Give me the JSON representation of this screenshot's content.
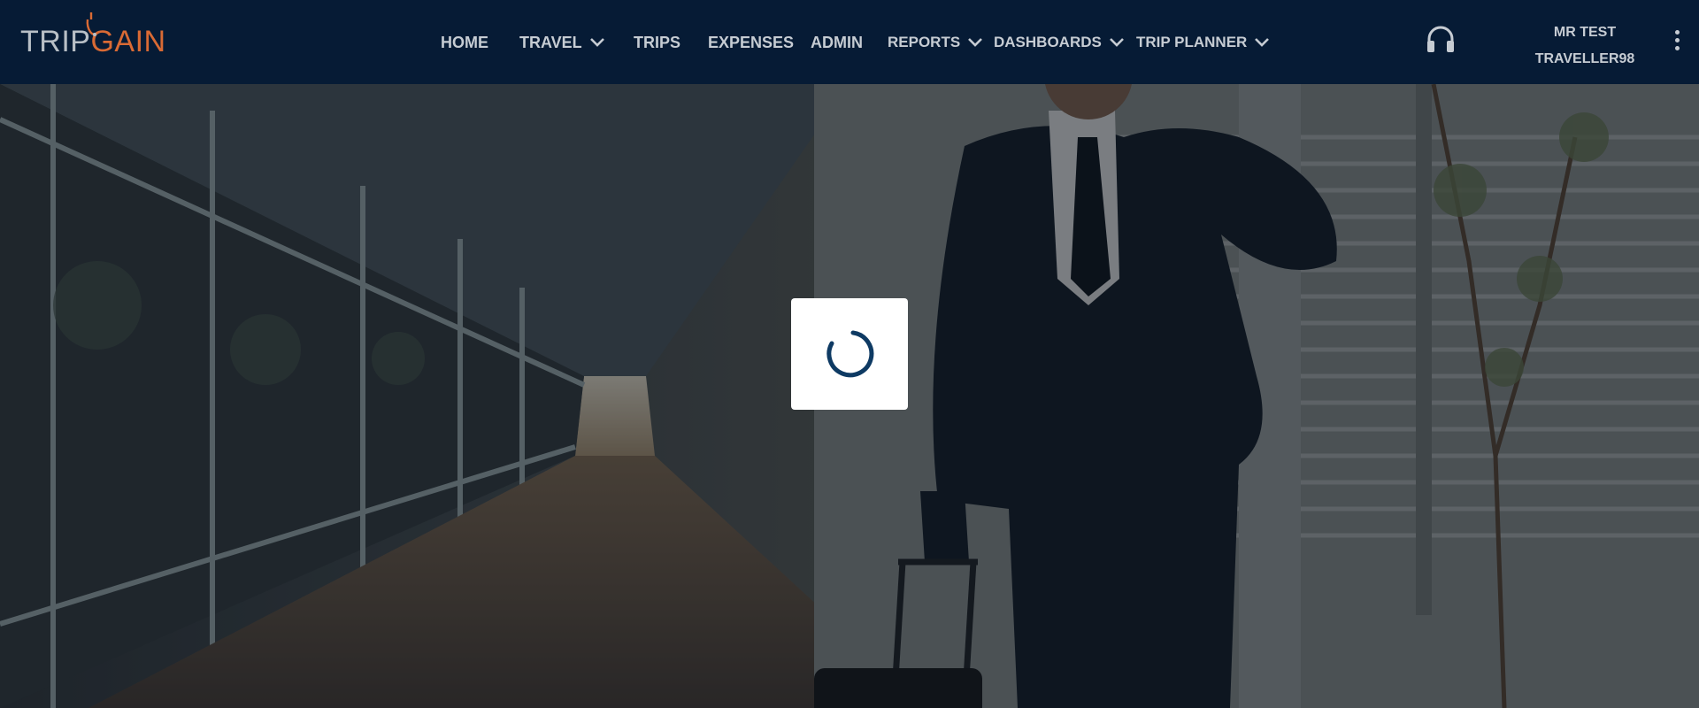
{
  "brand": {
    "logo_trip": "TRIP",
    "logo_gain": "GAIN",
    "logo_accent": "#d96a34",
    "navbar_bg": "#061b35"
  },
  "nav": {
    "home": "HOME",
    "travel": "TRAVEL",
    "trips": "TRIPS",
    "expenses": "EXPENSES",
    "admin": "ADMIN",
    "reports": "REPORTS",
    "dashboards": "DASHBOARDS",
    "trip_planner": "TRIP PLANNER"
  },
  "user": {
    "line1": "MR TEST",
    "line2": "TRAVELLER98"
  },
  "icons": {
    "support": "headset-icon",
    "menu": "kebab-menu-icon",
    "dropdown": "chevron-down-icon",
    "loader": "spinner-icon"
  },
  "loader": {
    "state": "loading",
    "color": "#0e3a63"
  }
}
